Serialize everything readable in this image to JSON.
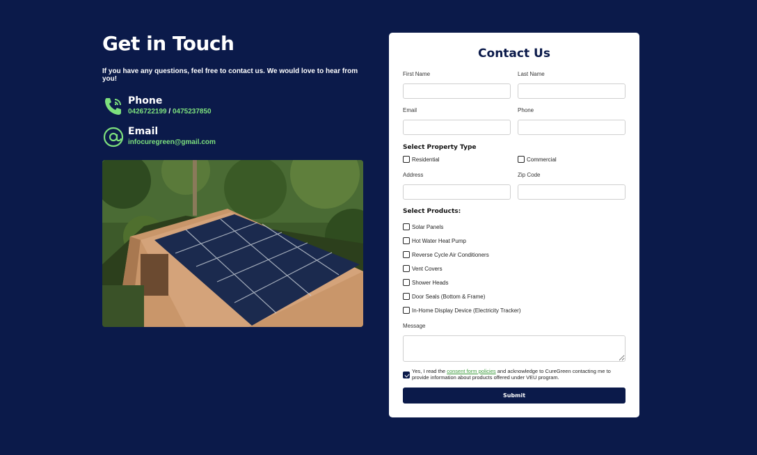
{
  "left": {
    "title": "Get in Touch",
    "intro": "If you have any questions, feel free to contact us. We would love to hear from you!",
    "phone": {
      "label": "Phone",
      "number1": "0426722199",
      "separator": " / ",
      "number2": "0475237850",
      "icon": "phone-icon"
    },
    "email": {
      "label": "Email",
      "value": "infocuregreen@gmail.com",
      "icon": "at-sign-icon"
    },
    "accent_color": "#7de07d"
  },
  "form": {
    "title": "Contact Us",
    "first_name_label": "First Name",
    "last_name_label": "Last Name",
    "email_label": "Email",
    "phone_label": "Phone",
    "property_type_heading": "Select Property Type",
    "property_types": [
      {
        "label": "Residential",
        "checked": false
      },
      {
        "label": "Commercial",
        "checked": false
      }
    ],
    "address_label": "Address",
    "zip_label": "Zip Code",
    "products_heading": "Select Products:",
    "products": [
      {
        "label": "Solar Panels",
        "checked": false
      },
      {
        "label": "Hot Water Heat Pump",
        "checked": false
      },
      {
        "label": "Reverse Cycle Air Conditioners",
        "checked": false
      },
      {
        "label": "Vent Covers",
        "checked": false
      },
      {
        "label": "Shower Heads",
        "checked": false
      },
      {
        "label": "Door Seals (Bottom & Frame)",
        "checked": false
      },
      {
        "label": "In-Home Display Device (Electricity Tracker)",
        "checked": false
      }
    ],
    "message_label": "Message",
    "consent": {
      "checked": true,
      "prefix": "Yes, I read the ",
      "link": "consent form policies",
      "suffix": " and acknowledge to CureGreen contacting me to provide information about products offered under VEU program."
    },
    "submit_label": "Submit"
  },
  "colors": {
    "background": "#0b1a4a",
    "card": "#ffffff",
    "accent": "#7de07d"
  }
}
